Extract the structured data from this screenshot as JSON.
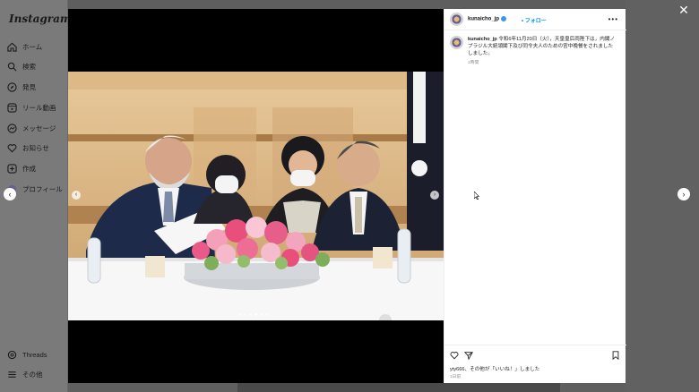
{
  "app": {
    "name": "Instagram"
  },
  "sidebar": {
    "items": [
      {
        "label": "ホーム",
        "icon": "home-icon"
      },
      {
        "label": "検索",
        "icon": "search-icon"
      },
      {
        "label": "発見",
        "icon": "compass-icon"
      },
      {
        "label": "リール動画",
        "icon": "reels-icon"
      },
      {
        "label": "メッセージ",
        "icon": "messenger-icon"
      },
      {
        "label": "お知らせ",
        "icon": "heart-icon"
      },
      {
        "label": "作成",
        "icon": "plus-square-icon"
      },
      {
        "label": "プロフィール",
        "icon": "profile-avatar"
      }
    ],
    "bottom": [
      {
        "label": "Threads",
        "icon": "threads-icon"
      },
      {
        "label": "その他",
        "icon": "menu-icon"
      }
    ]
  },
  "post": {
    "username": "kunaicho_jp",
    "follow_label": "フォロー",
    "more_label": "•••",
    "caption_text": "令和6年11月20日（火），天皇皇后両陛下は，内閣ノブラジル大統領閣下及び同令夫人のための宮中晩餐をされましたしました。",
    "caption_time": "1時間",
    "likes_text": "yty666、その他が「いいね！」しました",
    "post_time": "1日前",
    "carousel": {
      "count": 6,
      "active": 3
    }
  },
  "modal": {
    "close_label": "✕",
    "prev_label": "‹",
    "next_label": "›"
  },
  "colors": {
    "accent": "#0095f6",
    "overlay": "#5f5f5f",
    "verified": "#3897f0"
  }
}
